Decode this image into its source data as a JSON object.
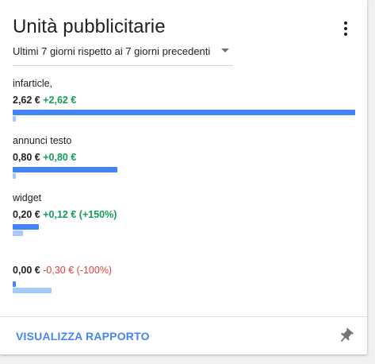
{
  "card": {
    "title": "Unità pubblicitarie",
    "date_range": "Ultimi 7 giorni rispetto ai 7 giorni precedenti",
    "footer_link": "VISUALIZZA RAPPORTO"
  },
  "colors": {
    "current_bar": "#4285f4",
    "previous_bar": "#a6c8fa",
    "positive_change": "#0f9d58",
    "negative_change": "#db4437",
    "link": "#4285f4"
  },
  "icons": {
    "menu": "more-vert-icon",
    "dropdown": "caret-down-icon",
    "pin": "pin-icon"
  },
  "units": [
    {
      "name": "infarticle,",
      "value": "2,62 €",
      "change": "+2,62 €",
      "trend": "up",
      "current": 2.62,
      "previous": 0.0
    },
    {
      "name": "annunci testo",
      "value": "0,80 €",
      "change": "+0,80 €",
      "trend": "up",
      "current": 0.8,
      "previous": 0.0
    },
    {
      "name": "widget",
      "value": "0,20 €",
      "change": "+0,12 € (+150%)",
      "trend": "up",
      "current": 0.2,
      "previous": 0.08
    },
    {
      "name": "",
      "value": "0,00 €",
      "change": "-0,30 € (-100%)",
      "trend": "down",
      "current": 0.0,
      "previous": 0.3
    }
  ]
}
